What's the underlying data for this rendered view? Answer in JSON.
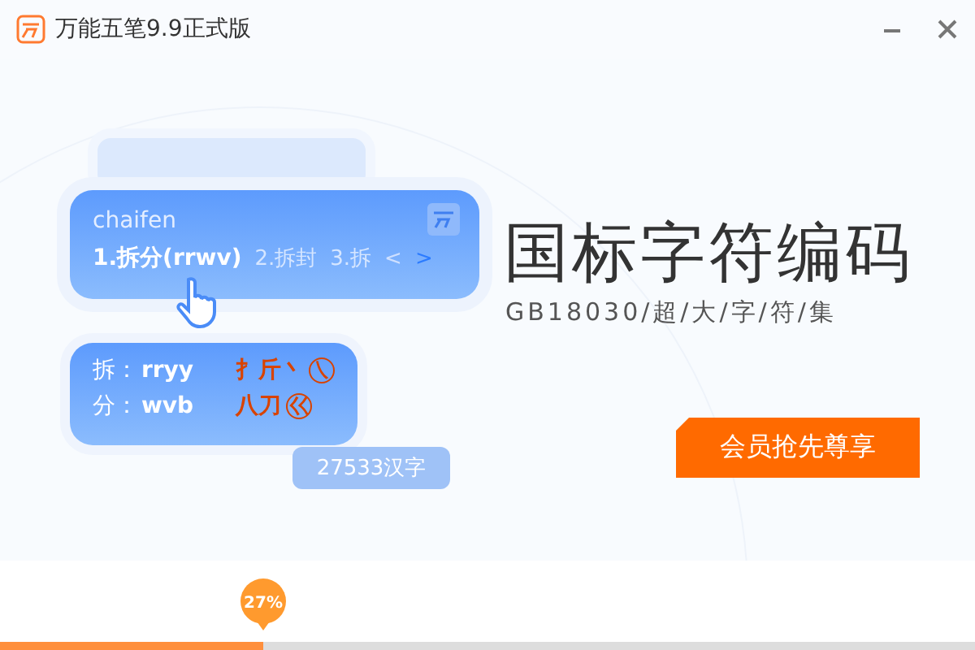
{
  "window": {
    "title": "万能五笔9.9正式版"
  },
  "input_card": {
    "pinyin": "chaifen",
    "candidates": [
      {
        "text": "1.拆分(rrwv)",
        "selected": true
      },
      {
        "text": "2.拆封",
        "selected": false
      },
      {
        "text": "3.拆",
        "selected": false
      }
    ],
    "prev": {
      "text": "<",
      "disabled": true
    },
    "next": {
      "text": ">",
      "disabled": false
    }
  },
  "code_card": {
    "rows": [
      {
        "char": "拆：",
        "code": "rryy",
        "roots": "扌斤丶",
        "key": "㇏"
      },
      {
        "char": "分：",
        "code": "wvb",
        "roots": "八刀",
        "key": "巜"
      }
    ]
  },
  "count_tag": "27533汉字",
  "headline": "国标字符编码",
  "subtitle": "GB18030/超/大/字/符/集",
  "cta": "会员抢先尊享",
  "progress": {
    "level": 0.27,
    "label": "27%"
  }
}
